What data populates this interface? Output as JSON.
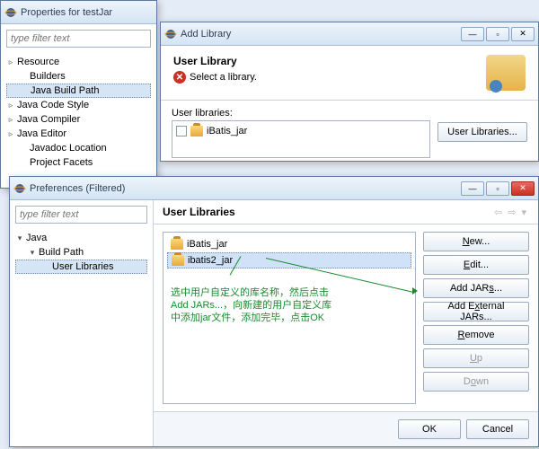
{
  "win1": {
    "title": "Properties for testJar",
    "filter_placeholder": "type filter text",
    "tree": [
      {
        "label": "Resource",
        "expand": "▹"
      },
      {
        "label": "Builders"
      },
      {
        "label": "Java Build Path",
        "selected": true
      },
      {
        "label": "Java Code Style",
        "expand": "▹"
      },
      {
        "label": "Java Compiler",
        "expand": "▹"
      },
      {
        "label": "Java Editor",
        "expand": "▹"
      },
      {
        "label": "Javadoc Location"
      },
      {
        "label": "Project Facets"
      }
    ]
  },
  "win2": {
    "title": "Add Library",
    "banner_title": "User Library",
    "banner_msg": "Select a library.",
    "list_label": "User libraries:",
    "items": [
      {
        "label": "iBatis_jar"
      }
    ],
    "btn_userlibs": "User Libraries..."
  },
  "win3": {
    "title": "Preferences (Filtered)",
    "filter_placeholder": "type filter text",
    "tree": {
      "root": "Java",
      "child": "Build Path",
      "leaf": "User Libraries"
    },
    "header": "User Libraries",
    "libs": [
      {
        "label": "iBatis_jar"
      },
      {
        "label": "ibatis2_jar",
        "selected": true
      }
    ],
    "buttons": {
      "new": "New...",
      "edit": "Edit...",
      "addjars": "Add JARs...",
      "addext": "Add External JARs...",
      "remove": "Remove",
      "up": "Up",
      "down": "Down"
    },
    "annotation": "选中用户自定义的库名称，然后点击\nAdd JARs...，向新建的用户自定义库\n中添加jar文件，添加完毕，点击OK",
    "footer": {
      "ok": "OK",
      "cancel": "Cancel"
    }
  }
}
